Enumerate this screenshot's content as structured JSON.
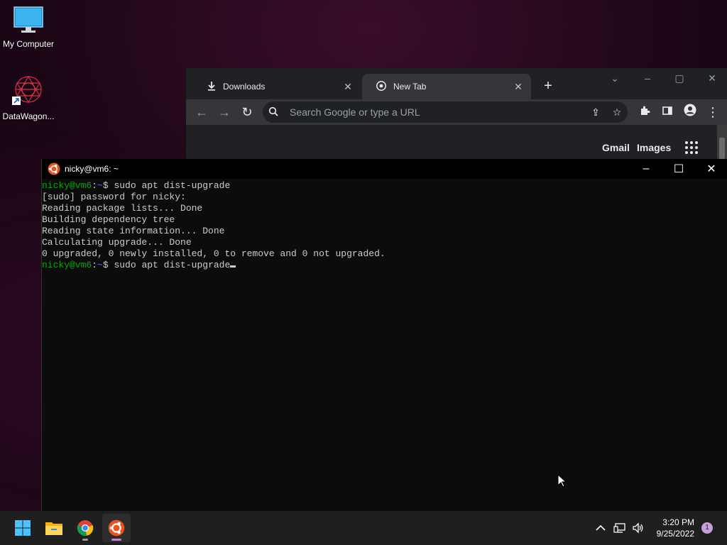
{
  "desktop": {
    "icons": [
      {
        "label": "My Computer"
      },
      {
        "label": "DataWagon..."
      }
    ]
  },
  "chrome": {
    "tabs": [
      {
        "label": "Downloads",
        "icon": "download-icon"
      },
      {
        "label": "New Tab",
        "icon": "chrome-icon"
      }
    ],
    "omnibox_placeholder": "Search Google or type a URL",
    "page_links": {
      "gmail": "Gmail",
      "images": "Images"
    }
  },
  "terminal": {
    "title": "nicky@vm6: ~",
    "prompt_user": "nicky@vm6",
    "prompt_path": "~",
    "lines": [
      {
        "type": "prompt",
        "command": "sudo apt dist-upgrade"
      },
      {
        "type": "output",
        "text": "[sudo] password for nicky:"
      },
      {
        "type": "output",
        "text": "Reading package lists... Done"
      },
      {
        "type": "output",
        "text": "Building dependency tree"
      },
      {
        "type": "output",
        "text": "Reading state information... Done"
      },
      {
        "type": "output",
        "text": "Calculating upgrade... Done"
      },
      {
        "type": "output",
        "text": "0 upgraded, 0 newly installed, 0 to remove and 0 not upgraded."
      },
      {
        "type": "prompt",
        "command": "sudo apt dist-upgrade",
        "cursor": true
      }
    ]
  },
  "taskbar": {
    "apps": [
      "windows-start-icon",
      "file-explorer-icon",
      "chrome-icon",
      "ubuntu-terminal-icon"
    ],
    "active_app": "ubuntu-terminal-icon",
    "clock_time": "3:20 PM",
    "clock_date": "9/25/2022",
    "notification_count": "1"
  },
  "colors": {
    "prompt_user": "#13a10e",
    "prompt_path": "#3b78ff",
    "terminal_bg": "#0c0c0c",
    "chrome_bg": "#35363a"
  }
}
